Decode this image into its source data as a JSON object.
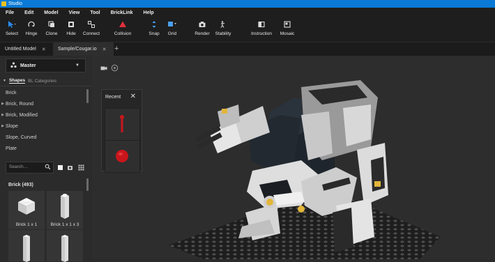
{
  "window": {
    "title": "Studio"
  },
  "menu": [
    "File",
    "Edit",
    "Model",
    "View",
    "Tool",
    "BrickLink",
    "Help"
  ],
  "toolbar": {
    "select": "Select",
    "hinge": "Hinge",
    "clone": "Clone",
    "hide": "Hide",
    "connect": "Connect",
    "collision": "Collision",
    "snap": "Snap",
    "grid": "Grid",
    "render": "Render",
    "stability": "Stability",
    "instruction": "Instruction",
    "mosaic": "Mosaic"
  },
  "tabs": [
    {
      "label": "Untitled Model",
      "close": "✕"
    },
    {
      "label": "Sample/Cougar.io",
      "close": "✕"
    }
  ],
  "tab_add": "+",
  "left": {
    "master": "Master",
    "subtabs": {
      "shapes": "Shapes",
      "bl_categories": "BL Categories"
    },
    "categories": [
      {
        "label": "Brick",
        "expandable": false
      },
      {
        "label": "Brick, Round",
        "expandable": true
      },
      {
        "label": "Brick, Modified",
        "expandable": true
      },
      {
        "label": "Slope",
        "expandable": true
      },
      {
        "label": "Slope, Curved",
        "expandable": false
      },
      {
        "label": "Plate",
        "expandable": false
      }
    ],
    "search_placeholder": "Search...",
    "brick_header": "Brick (493)",
    "bricks": [
      {
        "label": "Brick 1 x 1"
      },
      {
        "label": "Brick 1 x 1 x 3"
      },
      {
        "label": ""
      },
      {
        "label": ""
      }
    ]
  },
  "recent": {
    "title": "Recent",
    "close": "✕"
  },
  "colors": {
    "accent": "#0a7ad6",
    "collision": "#e0303a",
    "recent_part": "#c8161c"
  }
}
